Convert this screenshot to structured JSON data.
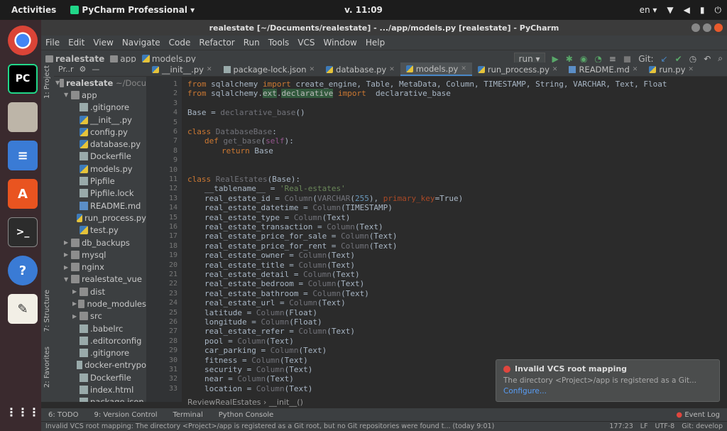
{
  "topbar": {
    "activities": "Activities",
    "app_menu": "PyCharm Professional ▾",
    "clock": "v. 11:09",
    "lang": "en ▾"
  },
  "window": {
    "title": "realestate [~/Documents/realestate] - .../app/models.py [realestate] - PyCharm"
  },
  "menu": [
    "File",
    "Edit",
    "View",
    "Navigate",
    "Code",
    "Refactor",
    "Run",
    "Tools",
    "VCS",
    "Window",
    "Help"
  ],
  "breadcrumb": [
    "realestate",
    "app",
    "models.py"
  ],
  "run_config": "run ▾",
  "git_label": "Git:",
  "project_panel": {
    "header": "Pr..r",
    "root": "realestate",
    "root_path": "~/Docu",
    "items": [
      {
        "label": "app",
        "indent": 1,
        "arrow": "▼",
        "icon": "folder"
      },
      {
        "label": ".gitignore",
        "indent": 2,
        "arrow": "",
        "icon": "file"
      },
      {
        "label": "__init__.py",
        "indent": 2,
        "arrow": "",
        "icon": "py"
      },
      {
        "label": "config.py",
        "indent": 2,
        "arrow": "",
        "icon": "py"
      },
      {
        "label": "database.py",
        "indent": 2,
        "arrow": "",
        "icon": "py"
      },
      {
        "label": "Dockerfile",
        "indent": 2,
        "arrow": "",
        "icon": "file"
      },
      {
        "label": "models.py",
        "indent": 2,
        "arrow": "",
        "icon": "py"
      },
      {
        "label": "Pipfile",
        "indent": 2,
        "arrow": "",
        "icon": "file"
      },
      {
        "label": "Pipfile.lock",
        "indent": 2,
        "arrow": "",
        "icon": "file"
      },
      {
        "label": "README.md",
        "indent": 2,
        "arrow": "",
        "icon": "md"
      },
      {
        "label": "run_process.py",
        "indent": 2,
        "arrow": "",
        "icon": "py"
      },
      {
        "label": "test.py",
        "indent": 2,
        "arrow": "",
        "icon": "py"
      },
      {
        "label": "db_backups",
        "indent": 1,
        "arrow": "▶",
        "icon": "folder"
      },
      {
        "label": "mysql",
        "indent": 1,
        "arrow": "▶",
        "icon": "folder"
      },
      {
        "label": "nginx",
        "indent": 1,
        "arrow": "▶",
        "icon": "folder"
      },
      {
        "label": "realestate_vue",
        "indent": 1,
        "arrow": "▼",
        "icon": "folder"
      },
      {
        "label": "dist",
        "indent": 2,
        "arrow": "▶",
        "icon": "folder"
      },
      {
        "label": "node_modules",
        "indent": 2,
        "arrow": "▶",
        "icon": "folder"
      },
      {
        "label": "src",
        "indent": 2,
        "arrow": "▶",
        "icon": "folder"
      },
      {
        "label": ".babelrc",
        "indent": 2,
        "arrow": "",
        "icon": "file"
      },
      {
        "label": ".editorconfig",
        "indent": 2,
        "arrow": "",
        "icon": "file"
      },
      {
        "label": ".gitignore",
        "indent": 2,
        "arrow": "",
        "icon": "file"
      },
      {
        "label": "docker-entrypo",
        "indent": 2,
        "arrow": "",
        "icon": "file"
      },
      {
        "label": "Dockerfile",
        "indent": 2,
        "arrow": "",
        "icon": "file"
      },
      {
        "label": "index.html",
        "indent": 2,
        "arrow": "",
        "icon": "file"
      },
      {
        "label": "package.json",
        "indent": 2,
        "arrow": "",
        "icon": "file"
      }
    ]
  },
  "tabs": [
    "__init__.py",
    "package-lock.json",
    "database.py",
    "models.py",
    "run_process.py",
    "README.md",
    "run.py"
  ],
  "side_labels": [
    "1: Project",
    "7: Structure",
    "2: Favorites"
  ],
  "code": [
    {
      "n": 1,
      "indent": 0,
      "parts": [
        [
          "kw",
          "from "
        ],
        [
          "plain",
          "sqlalchemy "
        ],
        [
          "kw",
          "import "
        ],
        [
          "plain",
          "create_engine, Table, MetaData, Column, TIMESTAMP, String, VARCHAR, Text, Float"
        ]
      ]
    },
    {
      "n": 2,
      "indent": 0,
      "parts": [
        [
          "kw",
          "from "
        ],
        [
          "plain",
          "sqlalchemy."
        ],
        [
          "hl",
          "ext"
        ],
        [
          "plain",
          "."
        ],
        [
          "hl",
          "declarative"
        ],
        [
          "kw",
          " import "
        ],
        [
          "plain",
          " declarative_base"
        ]
      ]
    },
    {
      "n": 3,
      "indent": 0,
      "parts": []
    },
    {
      "n": 4,
      "indent": 0,
      "parts": [
        [
          "plain",
          "Base = "
        ],
        [
          "dim",
          "declarative_base"
        ],
        [
          "plain",
          "()"
        ]
      ]
    },
    {
      "n": 5,
      "indent": 0,
      "parts": []
    },
    {
      "n": 6,
      "indent": 0,
      "parts": [
        [
          "kw",
          "class "
        ],
        [
          "dim",
          "DatabaseBase"
        ],
        [
          "plain",
          ":"
        ]
      ]
    },
    {
      "n": 7,
      "indent": 1,
      "parts": [
        [
          "kw",
          "def "
        ],
        [
          "dim",
          "get_base"
        ],
        [
          "plain",
          "("
        ],
        [
          "selfc",
          "self"
        ],
        [
          "plain",
          "):"
        ]
      ]
    },
    {
      "n": 8,
      "indent": 2,
      "parts": [
        [
          "kw",
          "return "
        ],
        [
          "plain",
          "Base"
        ]
      ]
    },
    {
      "n": 9,
      "indent": 0,
      "parts": []
    },
    {
      "n": 10,
      "indent": 0,
      "parts": []
    },
    {
      "n": 11,
      "indent": 0,
      "parts": [
        [
          "kw",
          "class "
        ],
        [
          "dim",
          "RealEstates"
        ],
        [
          "plain",
          "(Base):"
        ]
      ]
    },
    {
      "n": 12,
      "indent": 1,
      "parts": [
        [
          "plain",
          "__tablename__ = "
        ],
        [
          "str",
          "'Real-estates'"
        ]
      ]
    },
    {
      "n": 13,
      "indent": 1,
      "parts": [
        [
          "plain",
          "real_estate_id = "
        ],
        [
          "dim",
          "Column"
        ],
        [
          "plain",
          "("
        ],
        [
          "dim",
          "VARCHAR"
        ],
        [
          "plain",
          "("
        ],
        [
          "num",
          "255"
        ],
        [
          "plain",
          "), "
        ],
        [
          "par",
          "primary_key"
        ],
        [
          "plain",
          "=True)"
        ]
      ]
    },
    {
      "n": 14,
      "indent": 1,
      "parts": [
        [
          "plain",
          "real_estate_datetime = "
        ],
        [
          "dim",
          "Column"
        ],
        [
          "plain",
          "(TIMESTAMP)"
        ]
      ]
    },
    {
      "n": 15,
      "indent": 1,
      "parts": [
        [
          "plain",
          "real_estate_type = "
        ],
        [
          "dim",
          "Column"
        ],
        [
          "plain",
          "(Text)"
        ]
      ]
    },
    {
      "n": 16,
      "indent": 1,
      "parts": [
        [
          "plain",
          "real_estate_transaction = "
        ],
        [
          "dim",
          "Column"
        ],
        [
          "plain",
          "(Text)"
        ]
      ]
    },
    {
      "n": 17,
      "indent": 1,
      "parts": [
        [
          "plain",
          "real_estate_price_for_sale = "
        ],
        [
          "dim",
          "Column"
        ],
        [
          "plain",
          "(Text)"
        ]
      ]
    },
    {
      "n": 18,
      "indent": 1,
      "parts": [
        [
          "plain",
          "real_estate_price_for_rent = "
        ],
        [
          "dim",
          "Column"
        ],
        [
          "plain",
          "(Text)"
        ]
      ]
    },
    {
      "n": 19,
      "indent": 1,
      "parts": [
        [
          "plain",
          "real_estate_owner = "
        ],
        [
          "dim",
          "Column"
        ],
        [
          "plain",
          "(Text)"
        ]
      ]
    },
    {
      "n": 20,
      "indent": 1,
      "parts": [
        [
          "plain",
          "real_estate_title = "
        ],
        [
          "dim",
          "Column"
        ],
        [
          "plain",
          "(Text)"
        ]
      ]
    },
    {
      "n": 21,
      "indent": 1,
      "parts": [
        [
          "plain",
          "real_estate_detail = "
        ],
        [
          "dim",
          "Column"
        ],
        [
          "plain",
          "(Text)"
        ]
      ]
    },
    {
      "n": 22,
      "indent": 1,
      "parts": [
        [
          "plain",
          "real_estate_bedroom = "
        ],
        [
          "dim",
          "Column"
        ],
        [
          "plain",
          "(Text)"
        ]
      ]
    },
    {
      "n": 23,
      "indent": 1,
      "parts": [
        [
          "plain",
          "real_estate_bathroom = "
        ],
        [
          "dim",
          "Column"
        ],
        [
          "plain",
          "(Text)"
        ]
      ]
    },
    {
      "n": 24,
      "indent": 1,
      "parts": [
        [
          "plain",
          "real_estate_url = "
        ],
        [
          "dim",
          "Column"
        ],
        [
          "plain",
          "(Text)"
        ]
      ]
    },
    {
      "n": 25,
      "indent": 1,
      "parts": [
        [
          "plain",
          "latitude = "
        ],
        [
          "dim",
          "Column"
        ],
        [
          "plain",
          "(Float)"
        ]
      ]
    },
    {
      "n": 26,
      "indent": 1,
      "parts": [
        [
          "plain",
          "longitude = "
        ],
        [
          "dim",
          "Column"
        ],
        [
          "plain",
          "(Float)"
        ]
      ]
    },
    {
      "n": 27,
      "indent": 1,
      "parts": [
        [
          "plain",
          "real_estate_refer = "
        ],
        [
          "dim",
          "Column"
        ],
        [
          "plain",
          "(Text)"
        ]
      ]
    },
    {
      "n": 28,
      "indent": 1,
      "parts": [
        [
          "plain",
          "pool = "
        ],
        [
          "dim",
          "Column"
        ],
        [
          "plain",
          "(Text)"
        ]
      ]
    },
    {
      "n": 29,
      "indent": 1,
      "parts": [
        [
          "plain",
          "car_parking = "
        ],
        [
          "dim",
          "Column"
        ],
        [
          "plain",
          "(Text)"
        ]
      ]
    },
    {
      "n": 30,
      "indent": 1,
      "parts": [
        [
          "plain",
          "fitness = "
        ],
        [
          "dim",
          "Column"
        ],
        [
          "plain",
          "(Text)"
        ]
      ]
    },
    {
      "n": 31,
      "indent": 1,
      "parts": [
        [
          "plain",
          "security = "
        ],
        [
          "dim",
          "Column"
        ],
        [
          "plain",
          "(Text)"
        ]
      ]
    },
    {
      "n": 32,
      "indent": 1,
      "parts": [
        [
          "plain",
          "near = "
        ],
        [
          "dim",
          "Column"
        ],
        [
          "plain",
          "(Text)"
        ]
      ]
    },
    {
      "n": 33,
      "indent": 1,
      "parts": [
        [
          "plain",
          "location = "
        ],
        [
          "dim",
          "Column"
        ],
        [
          "plain",
          "(Text)"
        ]
      ]
    }
  ],
  "editor_breadcrumb": "ReviewRealEstates  ›  __init__()",
  "notification": {
    "title": "Invalid VCS root mapping",
    "body": "The directory <Project>/app is registered as a Git...",
    "action": "Configure..."
  },
  "bottom_tools": [
    "6: TODO",
    "9: Version Control",
    "Terminal",
    "Python Console"
  ],
  "event_log": "Event Log",
  "status": {
    "message": "Invalid VCS root mapping: The directory <Project>/app is registered as a Git root, but no Git repositories were found t... (today 9:01)",
    "position": "177:23",
    "line_sep": "LF",
    "encoding": "UTF-8",
    "branch": "Git: develop"
  },
  "colors": {
    "accent": "#4a88c7",
    "editor_bg": "#2b2b2b",
    "keyword": "#cc7832",
    "string": "#6a8759",
    "error": "#e0463e"
  }
}
